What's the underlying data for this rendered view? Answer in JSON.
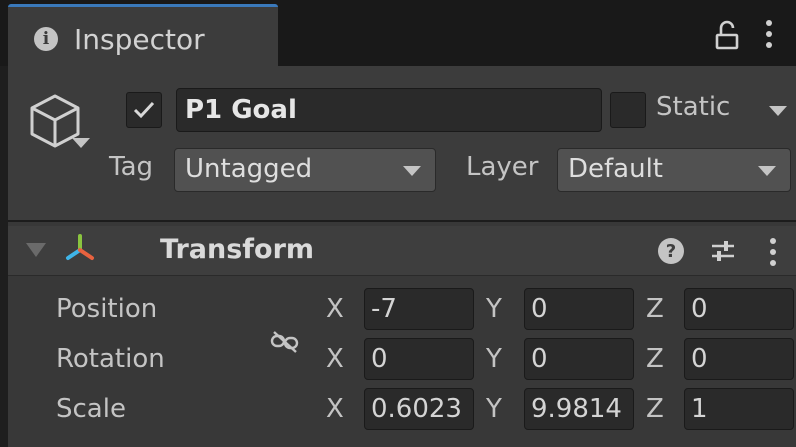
{
  "tab": {
    "title": "Inspector"
  },
  "gameobject": {
    "name": "P1 Goal",
    "active": true,
    "static_label": "Static",
    "static": false,
    "tag_label": "Tag",
    "tag_value": "Untagged",
    "layer_label": "Layer",
    "layer_value": "Default"
  },
  "component": {
    "title": "Transform",
    "axes": {
      "x": "X",
      "y": "Y",
      "z": "Z"
    },
    "rows": [
      {
        "label": "Position",
        "x": "-7",
        "y": "0",
        "z": "0"
      },
      {
        "label": "Rotation",
        "x": "0",
        "y": "0",
        "z": "0"
      },
      {
        "label": "Scale",
        "x": "0.6023",
        "y": "9.9814",
        "z": "1"
      }
    ]
  },
  "icons": {
    "tab": "info-icon",
    "lock": "lock-icon",
    "menu": "kebab-menu-icon",
    "object": "cube-icon",
    "transform": "transform-icon",
    "help": "help-icon",
    "presets": "presets-icon",
    "link": "constrain-proportions-icon"
  },
  "colors": {
    "accent": "#3a79bb",
    "panel": "#383838",
    "field": "#2a2a2a"
  }
}
